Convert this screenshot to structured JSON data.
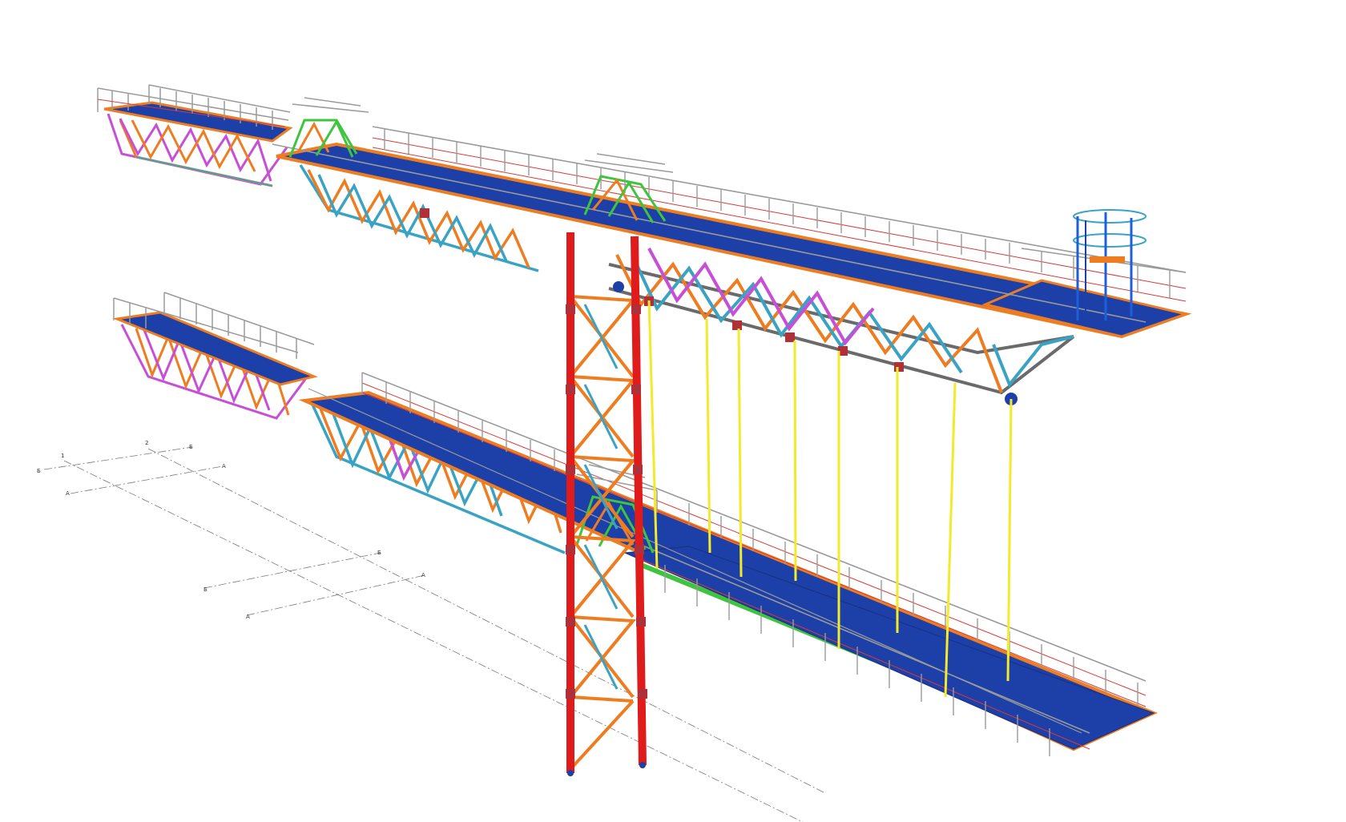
{
  "grid_labels": {
    "upper_1": "1",
    "upper_2": "2",
    "upper_b_left": "Б",
    "upper_b_right": "Б",
    "upper_a_left": "А",
    "upper_a_right": "А",
    "lower_b_left": "Б",
    "lower_b_right": "Б",
    "lower_a_left": "А",
    "lower_a_right": "А"
  },
  "colors": {
    "background": "#ffffff",
    "deck": "#1c3fa8",
    "deck_edge": "#1a2f80",
    "beam_orange": "#ee7d22",
    "brace_cyan": "#3aa3c4",
    "brace_magenta": "#c74fd6",
    "column_red": "#e01b1b",
    "handrail_gray": "#9a9a9a",
    "handrail_red": "#d73a3a",
    "hanger_yellow": "#f2ea2a",
    "stringer_green": "#3ec43e",
    "bottom_chord_gray": "#6a6a6a",
    "node_plate": "#b0303a",
    "grid_line": "#7a7a7a"
  },
  "icons": {
    "structure": "steel-walkway-trestle-3d-model",
    "axis_markers": "grid-axis-marker"
  }
}
